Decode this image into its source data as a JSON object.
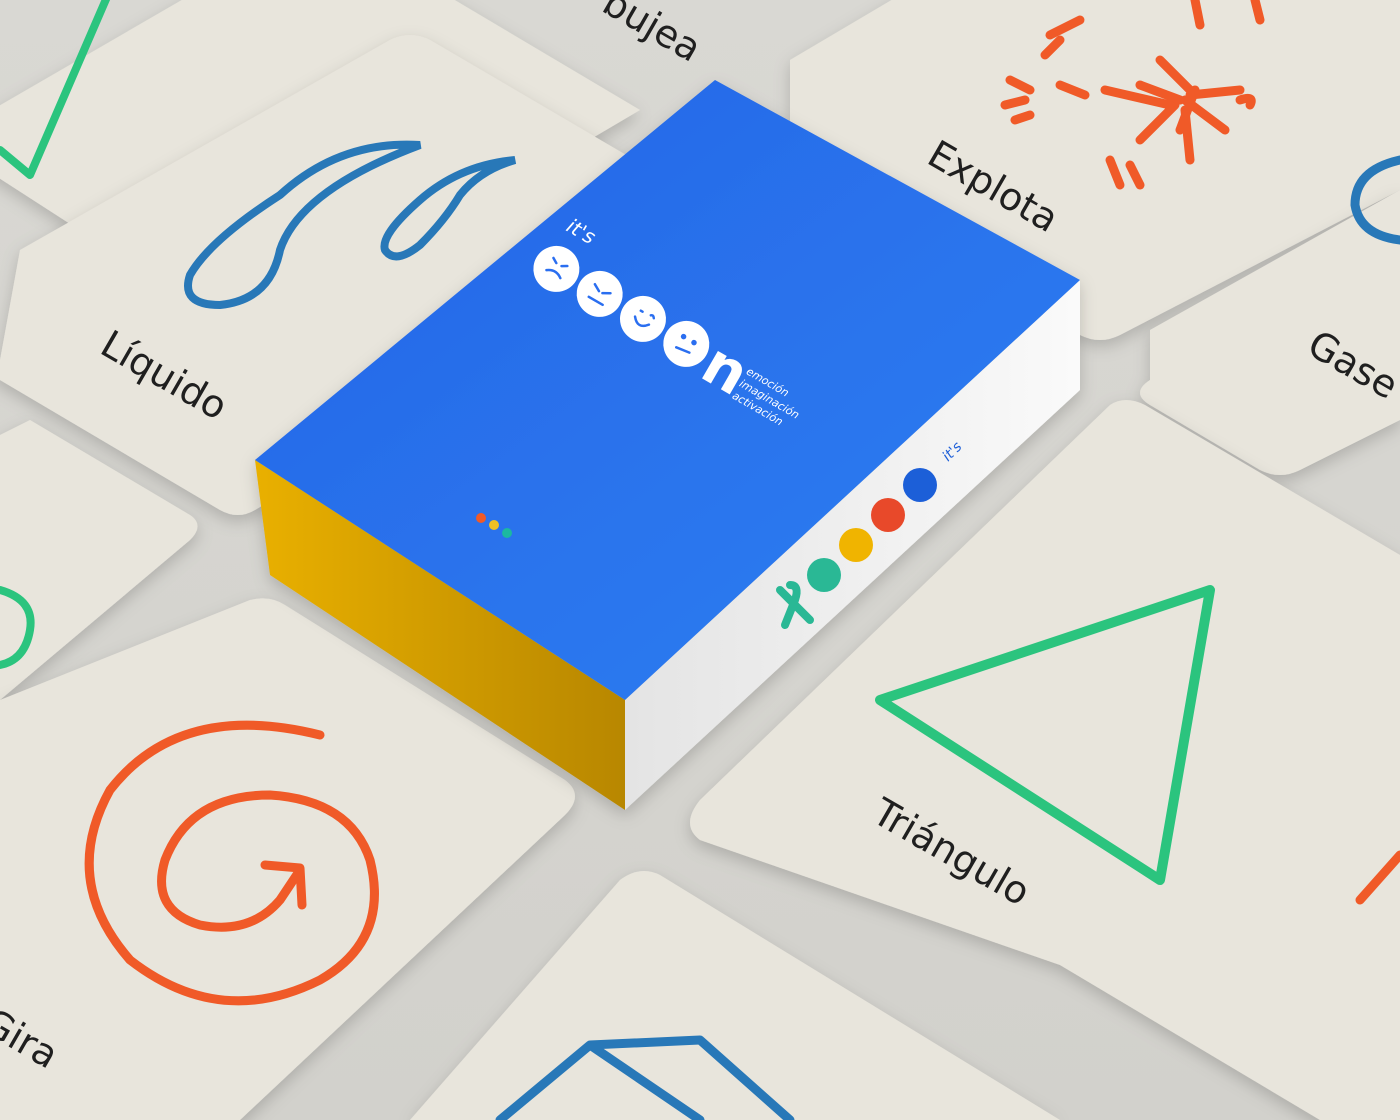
{
  "scene": {
    "description_free": true,
    "background_color": "#d5d4cf",
    "card_color": "#e8e5dc"
  },
  "cards": [
    {
      "label": "Líquido",
      "icon": "drop-icon",
      "color": "#2878b8"
    },
    {
      "label": "Explota",
      "icon": "burst-icon",
      "color": "#f05a28"
    },
    {
      "label": "Gase",
      "icon": "spiral-icon",
      "color": "#2878b8"
    },
    {
      "label": "Triángulo",
      "icon": "triangle-icon",
      "color": "#2bc47e"
    },
    {
      "label": "Gira",
      "icon": "spiral-arrow-icon",
      "color": "#f05a28"
    },
    {
      "label": "bujea",
      "icon": "zigzag-icon",
      "color": "#2bc47e"
    },
    {
      "label": "",
      "icon": "cube-icon",
      "color": "#2878b8"
    }
  ],
  "box": {
    "brand_prefix": "it's",
    "brand_suffix": "n",
    "tagline": [
      "emoción",
      "imaginación",
      "activación"
    ],
    "side_prefix": "it's",
    "colors": {
      "top": "#2a6ef0",
      "side": "#f2f2f2",
      "front": "#f0b400",
      "dot_red": "#f05a28",
      "dot_yellow": "#f0c020",
      "dot_teal": "#1bb8a0",
      "face_green": "#2bb895",
      "face_yellow": "#f0b400",
      "face_red": "#e84a2a",
      "face_blue": "#1e5ed8"
    }
  }
}
